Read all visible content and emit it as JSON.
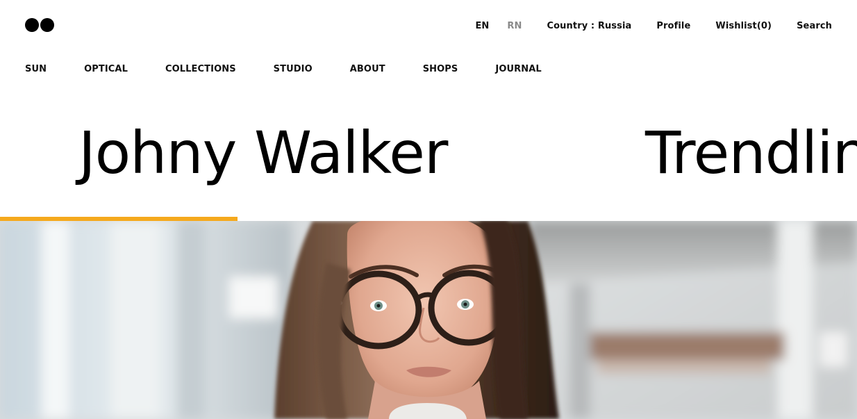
{
  "header": {
    "languages": [
      "EN",
      "RN"
    ],
    "country": "Country : Russia",
    "profile": "Profile",
    "wishlist": "Wishlist(0)",
    "search": "Search"
  },
  "main_nav": {
    "items": [
      "SUN",
      "OPTICAL",
      "COLLECTIONS",
      "STUDIO",
      "ABOUT",
      "SHOPS",
      "JOURNAL"
    ]
  },
  "slider": {
    "titles": [
      "Johny Walker",
      "Trendlin"
    ],
    "progress_fraction": 0.277
  },
  "colors": {
    "accent": "#f5a91d",
    "text": "#111111",
    "inactive_lang": "#8a8a8a"
  }
}
